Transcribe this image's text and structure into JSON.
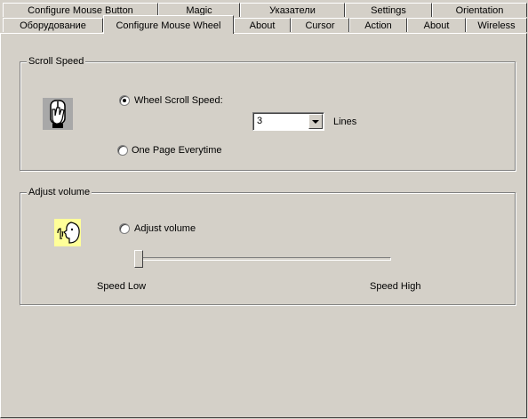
{
  "tabs": {
    "row1": [
      "Configure Mouse Button",
      "Magic",
      "Указатели",
      "Settings",
      "Orientation"
    ],
    "row2": [
      "Оборудование",
      "Configure Mouse Wheel",
      "About",
      "Cursor",
      "Action",
      "About",
      "Wireless"
    ],
    "active": "Configure Mouse Wheel"
  },
  "scroll_speed": {
    "title": "Scroll Speed",
    "icon": "mouse-wheel-hand-icon",
    "wheel_option_label": "Wheel Scroll Speed:",
    "wheel_option_selected": true,
    "lines_value": "3",
    "lines_label": "Lines",
    "page_option_label": "One Page Everytime",
    "page_option_selected": false
  },
  "adjust_volume": {
    "title": "Adjust volume",
    "icon": "speaker-face-icon",
    "option_label": "Adjust volume",
    "option_selected": false,
    "slider_value": 0,
    "slider_min_label": "Speed Low",
    "slider_max_label": "Speed High"
  },
  "colors": {
    "face": "#d4d0c8",
    "icon_background": "#ffff99"
  }
}
